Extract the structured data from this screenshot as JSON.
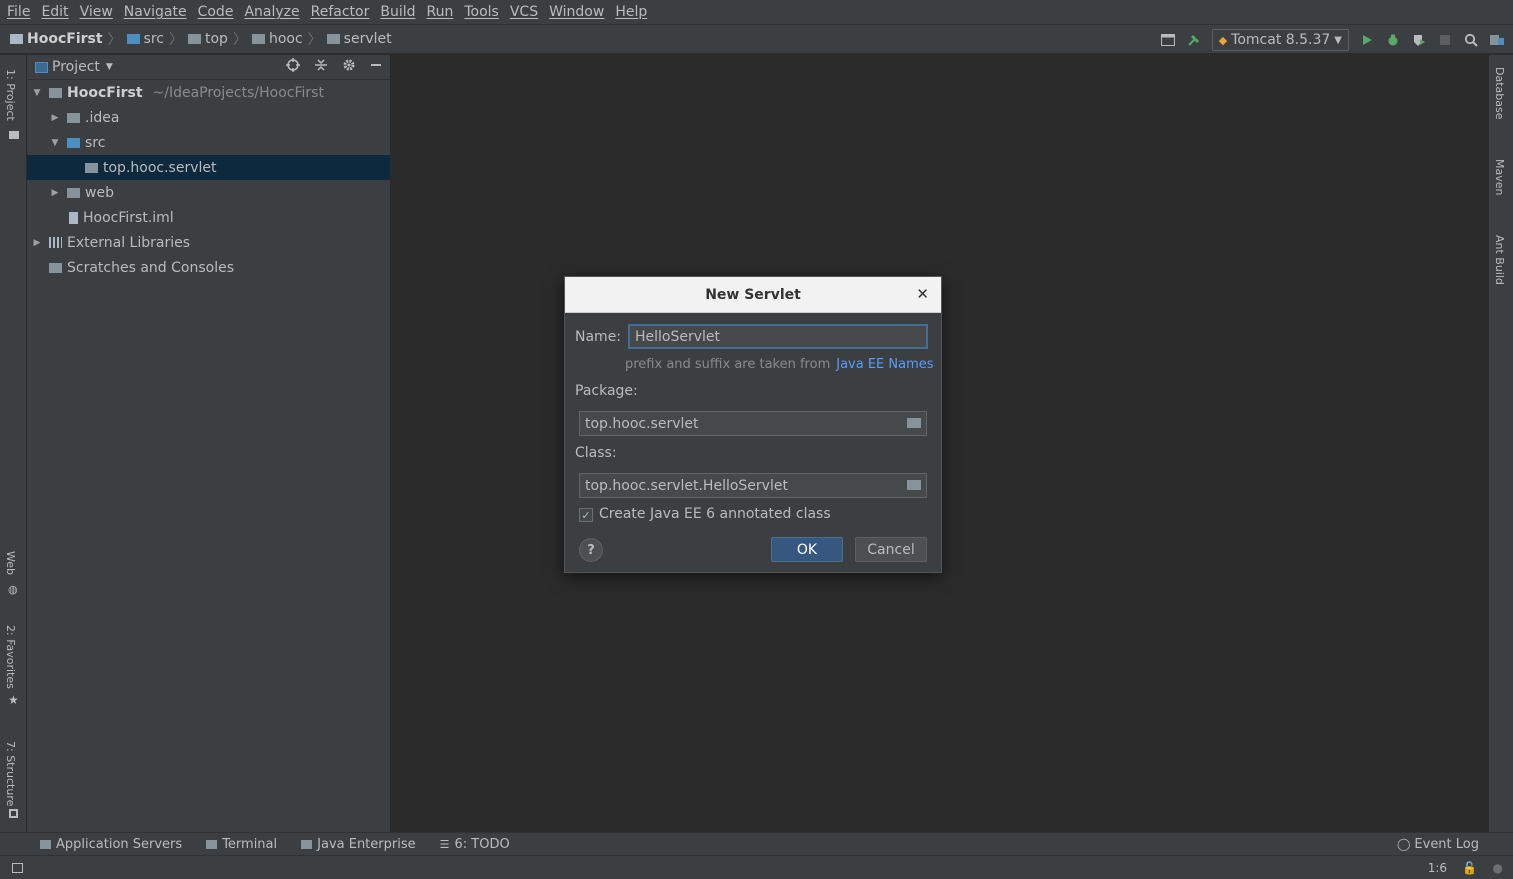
{
  "menu": [
    "File",
    "Edit",
    "View",
    "Navigate",
    "Code",
    "Analyze",
    "Refactor",
    "Build",
    "Run",
    "Tools",
    "VCS",
    "Window",
    "Help"
  ],
  "breadcrumb": [
    "HoocFirst",
    "src",
    "top",
    "hooc",
    "servlet"
  ],
  "run_config": "Tomcat 8.5.37",
  "project_panel": {
    "title": "Project",
    "tree": [
      {
        "label": "HoocFirst",
        "path": "~/IdeaProjects/HoocFirst"
      },
      {
        "label": ".idea"
      },
      {
        "label": "src"
      },
      {
        "label": "top.hooc.servlet"
      },
      {
        "label": "web"
      },
      {
        "label": "HoocFirst.iml"
      },
      {
        "label": "External Libraries"
      },
      {
        "label": "Scratches and Consoles"
      }
    ]
  },
  "dialog": {
    "title": "New Servlet",
    "name_label": "Name:",
    "name_value": "HelloServlet",
    "hint_text": "prefix and suffix are taken from",
    "hint_link": "Java EE Names",
    "package_label": "Package:",
    "package_value": "top.hooc.servlet",
    "class_label": "Class:",
    "class_value": "top.hooc.servlet.HelloServlet",
    "checkbox_label": "Create Java EE 6 annotated class",
    "checkbox_checked": true,
    "ok_label": "OK",
    "cancel_label": "Cancel",
    "help_label": "?"
  },
  "bottom_tabs": [
    "Application Servers",
    "Terminal",
    "Java Enterprise",
    "6: TODO"
  ],
  "event_log": "Event Log",
  "status": {
    "position": "1:6"
  },
  "colors": {
    "accent": "#365880",
    "selection": "#0d293e",
    "link": "#589df6"
  }
}
